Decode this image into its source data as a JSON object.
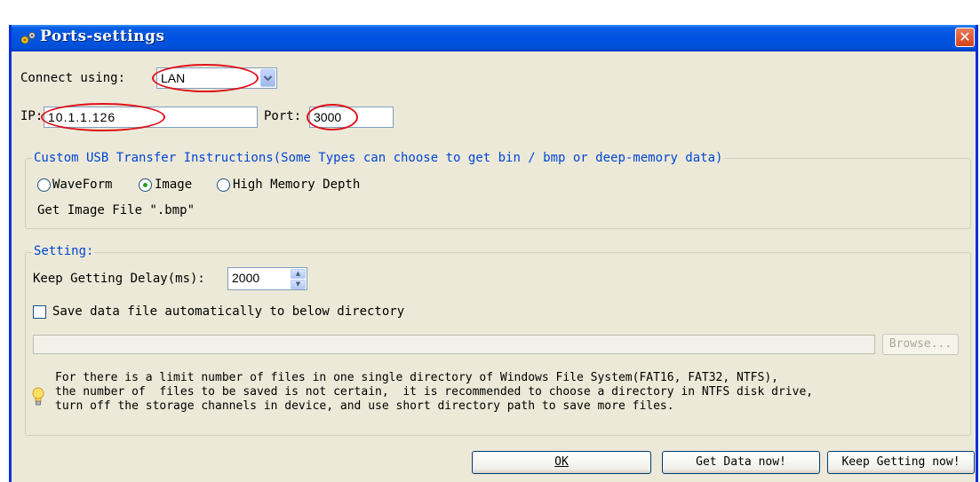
{
  "window": {
    "title": "Ports-settings",
    "close_symbol": "✕"
  },
  "connection": {
    "connect_label": "Connect using:",
    "connect_value": "LAN",
    "ip_label": "IP:",
    "ip_value": "10.1.1.126",
    "port_label": "Port:",
    "port_value": "3000"
  },
  "transfer": {
    "legend": "Custom USB Transfer Instructions(Some Types can choose to get bin / bmp or deep-memory data)",
    "options": [
      {
        "label": "WaveForm",
        "checked": false
      },
      {
        "label": "Image",
        "checked": true
      },
      {
        "label": "High Memory Depth",
        "checked": false
      }
    ],
    "file_info": "Get Image File \".bmp\""
  },
  "setting": {
    "legend": "Setting:",
    "delay_label": "Keep Getting Delay(ms):",
    "delay_value": "2000",
    "autosave_label": "Save data file automatically to below directory",
    "autosave_checked": false,
    "directory_value": "",
    "browse_label": "Browse...",
    "note_lines": [
      "For there is a limit number of files in one single directory of Windows File System(FAT16, FAT32, NTFS),",
      "the number of  files to be saved is not certain,  it is recommended to choose a directory in NTFS disk drive,",
      "turn off the storage channels in device, and use short directory path to save more files."
    ]
  },
  "buttons": {
    "ok": "OK",
    "get_data": "Get Data now!",
    "keep_getting": "Keep Getting now!"
  },
  "colors": {
    "title_bar": "#0054e3",
    "group_legend": "#0046d5",
    "highlight_oval": "#e0101a",
    "dialog_bg": "#ece9d8"
  },
  "icons": {
    "title": "settings-gears-icon",
    "close": "close-icon",
    "note": "lightbulb-icon"
  }
}
